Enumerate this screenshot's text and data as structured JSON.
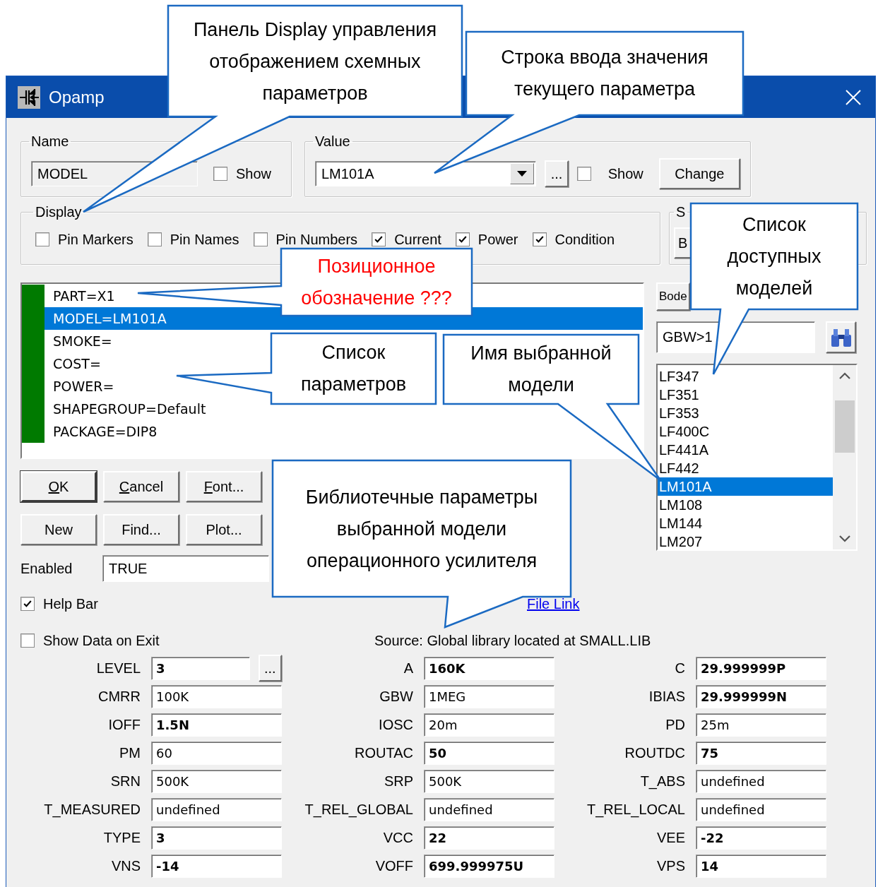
{
  "window": {
    "title": "Opamp"
  },
  "name_group": {
    "label": "Name",
    "value": "MODEL",
    "show": {
      "label": "Show",
      "checked": false
    }
  },
  "value_group": {
    "label": "Value",
    "value": "LM101A",
    "browse_button": "...",
    "show": {
      "label": "Show",
      "checked": false
    },
    "change_button": "Change"
  },
  "display_group": {
    "label": "Display",
    "options": [
      {
        "label": "Pin Markers",
        "checked": false
      },
      {
        "label": "Pin Names",
        "checked": false
      },
      {
        "label": "Pin Numbers",
        "checked": false
      },
      {
        "label": "Current",
        "checked": true
      },
      {
        "label": "Power",
        "checked": true
      },
      {
        "label": "Condition",
        "checked": true
      }
    ]
  },
  "shape_group": {
    "label": "S",
    "button": "B"
  },
  "parameters": [
    {
      "text": "PART=X1",
      "selected": false
    },
    {
      "text": "MODEL=LM101A",
      "selected": true
    },
    {
      "text": "SMOKE=",
      "selected": false
    },
    {
      "text": "COST=",
      "selected": false
    },
    {
      "text": "POWER=",
      "selected": false
    },
    {
      "text": "SHAPEGROUP=Default",
      "selected": false
    },
    {
      "text": "PACKAGE=DIP8",
      "selected": false
    }
  ],
  "bode_button": "Bode",
  "search": {
    "value": "GBW>1"
  },
  "models": [
    {
      "name": "LF347",
      "selected": false
    },
    {
      "name": "LF351",
      "selected": false
    },
    {
      "name": "LF353",
      "selected": false
    },
    {
      "name": "LF400C",
      "selected": false
    },
    {
      "name": "LF441A",
      "selected": false
    },
    {
      "name": "LF442",
      "selected": false
    },
    {
      "name": "LM101A",
      "selected": true
    },
    {
      "name": "LM108",
      "selected": false
    },
    {
      "name": "LM144",
      "selected": false
    },
    {
      "name": "LM207",
      "selected": false
    }
  ],
  "buttons": [
    [
      {
        "label": "OK",
        "underlined_first": true,
        "default": true
      },
      {
        "label": "Cancel",
        "underlined_first": true,
        "default": false
      },
      {
        "label": "Font...",
        "underlined_first": true,
        "default": false
      }
    ],
    [
      {
        "label": "New",
        "underlined_first": false,
        "default": false
      },
      {
        "label": "Find...",
        "underlined_first": false,
        "default": false
      },
      {
        "label": "Plot...",
        "underlined_first": false,
        "default": false
      }
    ]
  ],
  "enabled": {
    "label": "Enabled",
    "value": "TRUE"
  },
  "help_bar": {
    "label": "Help Bar",
    "checked": true
  },
  "file_link": "File Link",
  "show_data_on_exit": {
    "label": "Show Data on Exit",
    "checked": false
  },
  "source": "Source: Global library located at SMALL.LIB",
  "model_parameters": [
    {
      "name": "LEVEL",
      "value": "3",
      "modified": true,
      "button": "..."
    },
    {
      "name": "A",
      "value": "160K",
      "modified": true
    },
    {
      "name": "C",
      "value": "29.999999P",
      "modified": true
    },
    {
      "name": "CMRR",
      "value": "100K",
      "modified": false
    },
    {
      "name": "GBW",
      "value": "1MEG",
      "modified": false
    },
    {
      "name": "IBIAS",
      "value": "29.999999N",
      "modified": true
    },
    {
      "name": "IOFF",
      "value": "1.5N",
      "modified": true
    },
    {
      "name": "IOSC",
      "value": "20m",
      "modified": false
    },
    {
      "name": "PD",
      "value": "25m",
      "modified": false
    },
    {
      "name": "PM",
      "value": "60",
      "modified": false
    },
    {
      "name": "ROUTAC",
      "value": "50",
      "modified": true
    },
    {
      "name": "ROUTDC",
      "value": "75",
      "modified": true
    },
    {
      "name": "SRN",
      "value": "500K",
      "modified": false
    },
    {
      "name": "SRP",
      "value": "500K",
      "modified": false
    },
    {
      "name": "T_ABS",
      "value": "undefined",
      "modified": false
    },
    {
      "name": "T_MEASURED",
      "value": "undefined",
      "modified": false
    },
    {
      "name": "T_REL_GLOBAL",
      "value": "undefined",
      "modified": false
    },
    {
      "name": "T_REL_LOCAL",
      "value": "undefined",
      "modified": false
    },
    {
      "name": "TYPE",
      "value": "3",
      "modified": true
    },
    {
      "name": "VCC",
      "value": "22",
      "modified": true
    },
    {
      "name": "VEE",
      "value": "-22",
      "modified": true
    },
    {
      "name": "VNS",
      "value": "-14",
      "modified": true
    },
    {
      "name": "VOFF",
      "value": "699.999975U",
      "modified": true
    },
    {
      "name": "VPS",
      "value": "14",
      "modified": true
    }
  ],
  "callouts": [
    {
      "lines": [
        "Панель Display управления",
        "отображением схемных",
        "параметров"
      ],
      "color": "#000000"
    },
    {
      "lines": [
        "Строка ввода значения",
        "текущего параметра"
      ],
      "color": "#000000"
    },
    {
      "lines": [
        "Позиционное",
        "обозначение ???"
      ],
      "color": "#ff0000"
    },
    {
      "lines": [
        "Список",
        "доступных",
        "моделей"
      ],
      "color": "#000000"
    },
    {
      "lines": [
        "Список",
        "параметров"
      ],
      "color": "#000000"
    },
    {
      "lines": [
        "Имя выбранной",
        "модели"
      ],
      "color": "#000000"
    },
    {
      "lines": [
        "Библиотечные параметры",
        "выбранной модели",
        "операционного усилителя"
      ],
      "color": "#000000"
    }
  ]
}
